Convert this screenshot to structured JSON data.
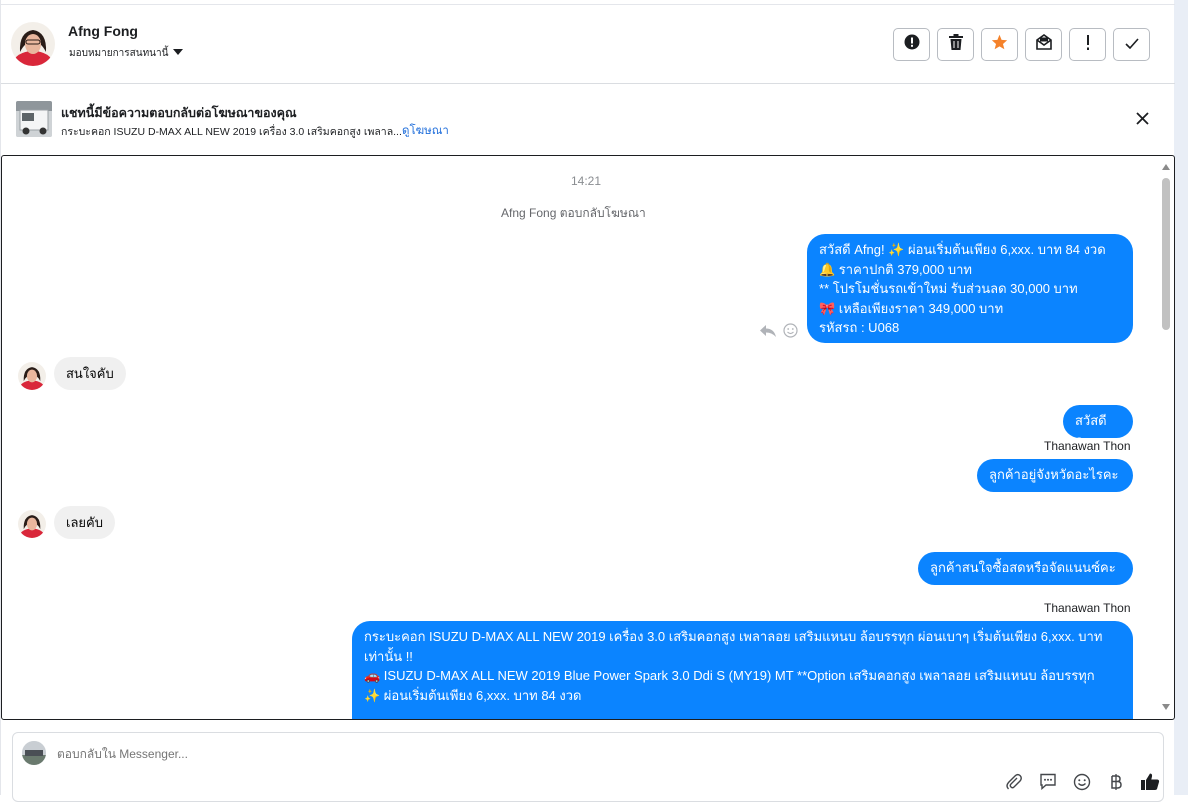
{
  "header": {
    "name": "Afng Fong",
    "assign_label": "มอบหมายการสนทนานี้"
  },
  "ad_banner": {
    "title": "แชทนี้มีข้อความตอบกลับต่อโฆษณาของคุณ",
    "description": "กระบะคอก ISUZU D-MAX ALL NEW 2019 เครื่อง 3.0 เสริมคอกสูง เพลาล...",
    "link": "ดูโฆษณา"
  },
  "thread": {
    "timestamp": "14:21",
    "system_note": "Afng Fong ตอบกลับโฆษณา",
    "messages": [
      {
        "text": "สวัสดี Afng! ✨ ผ่อนเริ่มต้นเพียง 6,xxx. บาท 84 งวด\n🔔 ราคาปกติ 379,000 บาท\n** โปรโมชั่นรถเข้าใหม่ รับส่วนลด 30,000 บาท\n🎀 เหลือเพียงราคา 349,000 บาท\nรหัสรถ : U068"
      },
      {
        "text": "สนใจคับ"
      },
      {
        "text": "สวัสดีคะ"
      },
      {
        "sender": "Thanawan Thon",
        "text": "ลูกค้าอยู่จังหวัดอะไรคะ"
      },
      {
        "text": "เลยคับ"
      },
      {
        "text": "ลูกค้าสนใจซื้อสดหรือจัดแนนซ์คะ"
      },
      {
        "sender": "Thanawan Thon",
        "text": "กระบะคอก ISUZU D-MAX ALL NEW 2019 เครื่อง 3.0 เสริมคอกสูง เพลาลอย เสริมแหนบ ล้อบรรทุก ผ่อนเบาๆ เริ่มต้นเพียง 6,xxx. บาท เท่านั้น !!\n🚗 ISUZU D-MAX ALL NEW 2019 Blue Power Spark 3.0 Ddi S (MY19) MT **Option เสริมคอกสูง เพลาลอย เสริมแหนบ ล้อบรรทุก\n✨ ผ่อนเริ่มต้นเพียง 6,xxx. บาท 84 งวด"
      }
    ]
  },
  "composer": {
    "placeholder": "ตอบกลับใน Messenger..."
  },
  "colors": {
    "outgoing_bubble": "#0b84ff",
    "incoming_bubble": "#f0f0f0",
    "link": "#216fdb",
    "star": "#f5822a"
  },
  "icons": [
    "alert-icon",
    "trash-icon",
    "star-icon",
    "mark-unread-icon",
    "priority-icon",
    "done-icon",
    "close-icon",
    "reply-icon",
    "smiley-icon",
    "attach-icon",
    "saved-reply-icon",
    "emoji-icon",
    "payment-icon",
    "like-icon",
    "caret-down-icon"
  ]
}
